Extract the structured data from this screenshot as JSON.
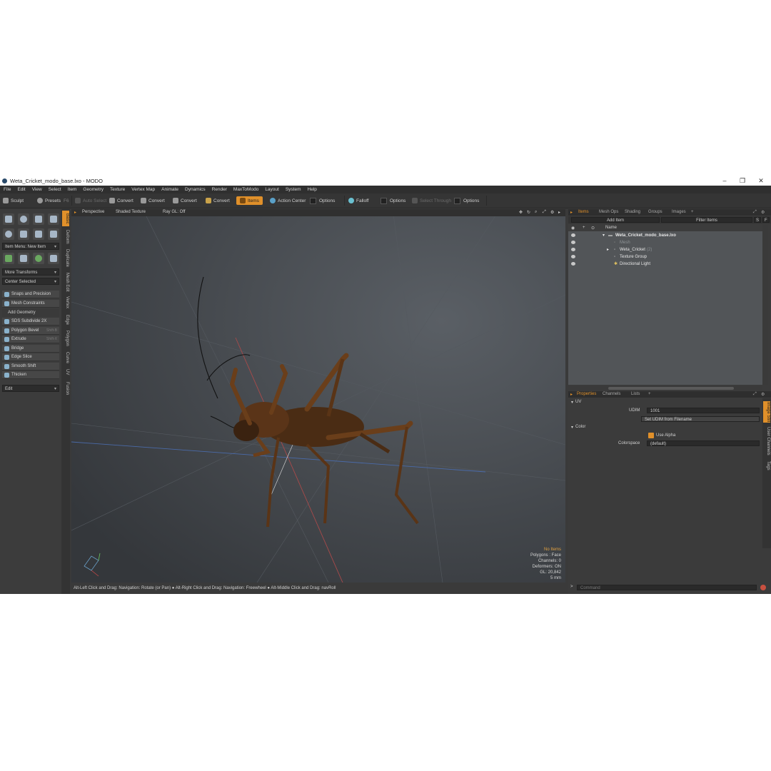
{
  "window": {
    "title": "Weta_Cricket_modo_base.lxo - MODO",
    "minimize": "–",
    "maximize": "❐",
    "close": "✕"
  },
  "menu": [
    "File",
    "Edit",
    "View",
    "Select",
    "Item",
    "Geometry",
    "Texture",
    "Vertex Map",
    "Animate",
    "Dynamics",
    "Render",
    "MaxToModo",
    "Layout",
    "System",
    "Help"
  ],
  "toolbar": {
    "sculpt": "Sculpt",
    "presets": "Presets",
    "presets_key": "F6",
    "auto_select": "Auto Select",
    "convert1": "Convert",
    "convert2": "Convert",
    "convert3": "Convert",
    "convert4": "Convert",
    "items": "Items",
    "action_center": "Action Center",
    "options1": "Options",
    "falloff": "Falloff",
    "options2": "Options",
    "select_through": "Select Through",
    "options3": "Options"
  },
  "left": {
    "item_menu": "Item Menu: New Item",
    "more_transforms": "More Transforms",
    "center_selected": "Center Selected",
    "snaps": "Snaps and Precision",
    "mesh_constraints": "Mesh Constraints",
    "add_geometry": "Add Geometry",
    "tools": [
      {
        "label": "SDS Subdivide 2X",
        "key": ""
      },
      {
        "label": "Polygon Bevel",
        "key": "Shift-B"
      },
      {
        "label": "Extrude",
        "key": "Shift-X"
      },
      {
        "label": "Bridge",
        "key": ""
      },
      {
        "label": "Edge Slice",
        "key": ""
      },
      {
        "label": "Smooth Shift",
        "key": ""
      },
      {
        "label": "Thicken",
        "key": ""
      }
    ],
    "edit": "Edit",
    "vtabs": [
      "Basic",
      "Deform",
      "Duplicate",
      "Mesh Edit",
      "Vertex",
      "Edge",
      "Polygon",
      "Curve",
      "UV",
      "Fusion"
    ]
  },
  "viewport": {
    "perspective": "Perspective",
    "shaded": "Shaded Texture",
    "raygl": "Ray GL: Off",
    "info": {
      "no_items": "No Items",
      "polygons": "Polygons : Face",
      "channels": "Channels: 0",
      "deformers": "Deformers: ON",
      "gl": "GL: 20,842",
      "scale": "5 mm"
    }
  },
  "status": "Alt-Left Click and Drag: Navigation: Rotate (or Pan) ● Alt-Right Click and Drag: Navigation: Freewheel ● Alt-Middle Click and Drag: navRoll",
  "right": {
    "tabs": [
      "Items",
      "Mesh Ops",
      "Shading",
      "Groups",
      "Images",
      "+"
    ],
    "add_item": "Add Item",
    "filter": "Filter Items",
    "name_col": "Name",
    "tree": [
      {
        "label": "Weta_Cricket_modo_base.lxo",
        "style": "bold"
      },
      {
        "label": "Mesh",
        "style": "dim"
      },
      {
        "label": "Weta_Cricket",
        "style": "normal",
        "suffix": "(2)"
      },
      {
        "label": "Texture Group",
        "style": "normal"
      },
      {
        "label": "Directional Light",
        "style": "normal"
      }
    ],
    "prop_tabs": [
      "Properties",
      "Channels",
      "Lists",
      "+"
    ],
    "uv_section": "UV",
    "udim_label": "UDIM",
    "udim_value": "1001",
    "set_udim": "Set UDIM from Filename",
    "color_section": "Color",
    "use_alpha": "Use Alpha",
    "colorspace_label": "Colorspace",
    "colorspace_value": "(default)",
    "side_tabs": [
      "Image Still",
      "User Channels",
      "Tags"
    ],
    "command_placeholder": "Command"
  }
}
